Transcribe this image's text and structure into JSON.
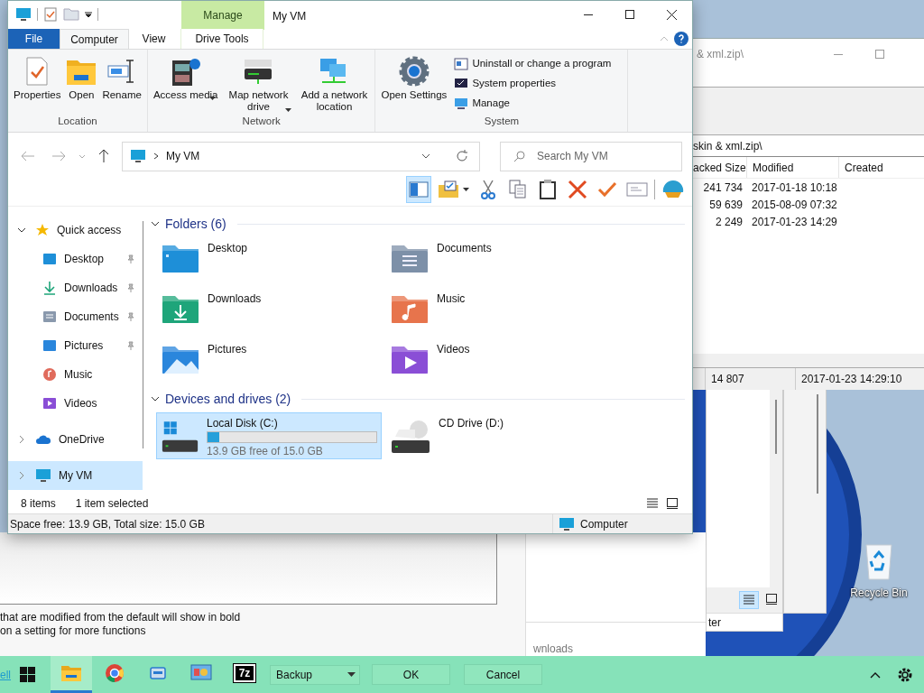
{
  "explorer": {
    "title": "My VM",
    "contextual_header": "Manage",
    "tabs": [
      {
        "label": "File",
        "kind": "file",
        "selected": false
      },
      {
        "label": "Computer",
        "kind": "tab",
        "selected": true
      },
      {
        "label": "View",
        "kind": "tab",
        "selected": false
      },
      {
        "label": "Drive Tools",
        "kind": "contextual",
        "selected": false
      }
    ],
    "ribbon_groups": [
      {
        "label": "Location",
        "commands": [
          {
            "label": "Properties",
            "kind": "properties",
            "dropdown": false
          },
          {
            "label": "Open",
            "kind": "open",
            "dropdown": false
          },
          {
            "label": "Rename",
            "kind": "rename",
            "dropdown": false
          }
        ]
      },
      {
        "label": "Network",
        "commands": [
          {
            "label": "Access media",
            "kind": "media",
            "dropdown": true
          },
          {
            "label": "Map network drive",
            "kind": "network-drive",
            "dropdown": true
          },
          {
            "label": "Add a network location",
            "kind": "network-location",
            "dropdown": false
          }
        ]
      },
      {
        "label": "System",
        "commands": [
          {
            "label": "Open Settings",
            "kind": "settings",
            "dropdown": false
          }
        ],
        "small_commands": [
          {
            "label": "Uninstall or change a program",
            "kind": "programs"
          },
          {
            "label": "System properties",
            "kind": "system"
          },
          {
            "label": "Manage",
            "kind": "manage"
          }
        ]
      }
    ],
    "address": {
      "path": "My VM"
    },
    "search": {
      "placeholder": "Search My VM"
    },
    "toolbar": [
      {
        "kind": "preview-pane",
        "selected": true
      },
      {
        "kind": "properties",
        "selected": false
      },
      {
        "kind": "cut",
        "selected": false
      },
      {
        "kind": "copy",
        "selected": false
      },
      {
        "kind": "paste",
        "selected": false
      },
      {
        "kind": "delete",
        "selected": false
      },
      {
        "kind": "check",
        "selected": false
      },
      {
        "kind": "mail",
        "selected": false
      },
      {
        "kind": "shell",
        "selected": false
      }
    ],
    "navigation": [
      {
        "label": "Quick access",
        "kind": "star",
        "expanded": true,
        "selected": false,
        "children": [
          {
            "label": "Desktop",
            "kind": "desktop",
            "pinned": true,
            "selected": false
          },
          {
            "label": "Downloads",
            "kind": "downloads",
            "pinned": true,
            "selected": false
          },
          {
            "label": "Documents",
            "kind": "documents",
            "pinned": true,
            "selected": false
          },
          {
            "label": "Pictures",
            "kind": "pictures",
            "pinned": true,
            "selected": false
          },
          {
            "label": "Music",
            "kind": "music",
            "pinned": false,
            "selected": false
          },
          {
            "label": "Videos",
            "kind": "videos",
            "pinned": false,
            "selected": false
          }
        ]
      },
      {
        "label": "OneDrive",
        "kind": "cloud",
        "expanded": false,
        "selected": false
      },
      {
        "label": "My VM",
        "kind": "pc",
        "expanded": false,
        "selected": true
      }
    ],
    "sections": [
      {
        "title": "Folders (6)",
        "expanded": true,
        "items": [
          {
            "label": "Desktop",
            "kind": "desktop",
            "selected": false
          },
          {
            "label": "Documents",
            "kind": "documents",
            "selected": false
          },
          {
            "label": "Downloads",
            "kind": "downloads",
            "selected": false
          },
          {
            "label": "Music",
            "kind": "music",
            "selected": false
          },
          {
            "label": "Pictures",
            "kind": "pictures",
            "selected": false
          },
          {
            "label": "Videos",
            "kind": "videos",
            "selected": false
          }
        ]
      },
      {
        "title": "Devices and drives (2)",
        "expanded": true,
        "items": [
          {
            "label": "Local Disk (C:)",
            "kind": "local-disk",
            "selected": true,
            "level": 0.07,
            "detail": "13.9 GB free of 15.0 GB"
          },
          {
            "label": "CD Drive (D:)",
            "kind": "cd-drive",
            "selected": false
          }
        ]
      }
    ],
    "status": {
      "count": "8 items",
      "selection": "1 item selected",
      "views": [
        {
          "kind": "details",
          "selected": false
        },
        {
          "kind": "large-icons",
          "selected": false
        }
      ]
    },
    "details_bar": {
      "space": "Space free: 13.9 GB, Total size: 15.0 GB",
      "location": "Computer"
    }
  },
  "archive_window": {
    "title": "& xml.zip\\",
    "path": "skin & xml.zip\\",
    "columns": [
      "acked Size",
      "Modified",
      "Created"
    ],
    "rows": [
      {
        "size": "241 734",
        "modified": "2017-01-18 10:18"
      },
      {
        "size": "59 639",
        "modified": "2015-08-09 07:32"
      },
      {
        "size": "2 249",
        "modified": "2017-01-23 14:29"
      }
    ],
    "status": [
      "14 807",
      "2017-01-23 14:29:10"
    ]
  },
  "lower_window": {
    "status": "ter",
    "views": [
      {
        "kind": "details",
        "selected": true
      },
      {
        "kind": "large-icons",
        "selected": false
      }
    ]
  },
  "settings_window": {
    "notes": [
      "that are modified from the default will show in bold",
      "on a setting for more functions"
    ]
  },
  "downloads_window": {
    "text": "wnloads"
  },
  "dialog": {
    "link": "ell",
    "dropdown": "Backup",
    "buttons": [
      "OK",
      "Cancel"
    ]
  },
  "taskbar": {
    "apps": [
      {
        "kind": "file-explorer",
        "selected": true
      },
      {
        "kind": "chrome",
        "selected": false
      },
      {
        "kind": "drive",
        "selected": false
      },
      {
        "kind": "control-panel",
        "selected": false
      },
      {
        "kind": "archiver",
        "selected": false,
        "label": "7z"
      }
    ]
  },
  "desktop": {
    "icons": [
      {
        "label": "Recycle Bin"
      }
    ]
  }
}
